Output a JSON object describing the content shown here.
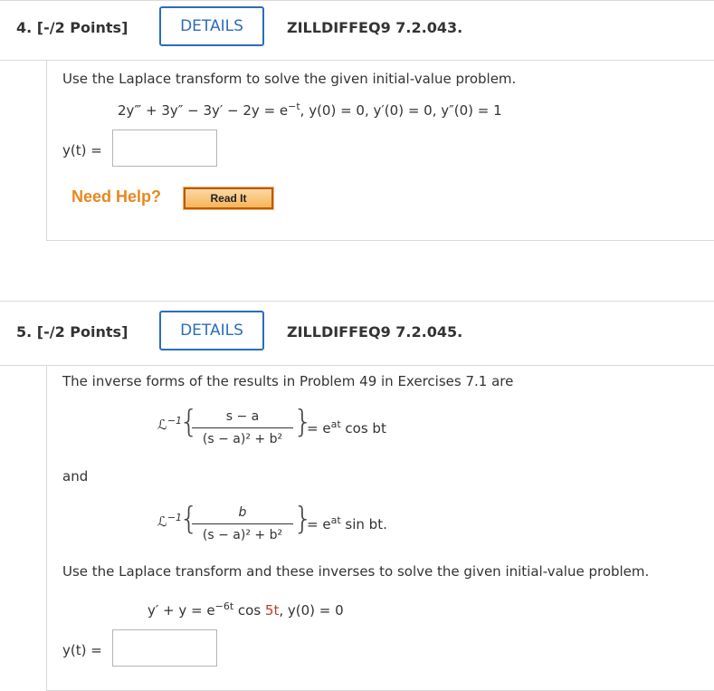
{
  "q4": {
    "number": "4.",
    "points": "[-/2 Points]",
    "details_label": "DETAILS",
    "id": "ZILLDIFFEQ9 7.2.043.",
    "prompt": "Use the Laplace transform to solve the given initial-value problem.",
    "equation": "2y‴ + 3y″ − 3y′ − 2y = e",
    "equation_exp": "−t",
    "conditions": ",   y(0) = 0,   y′(0) = 0,   y″(0) = 1",
    "answer_label": "y(t) =",
    "answer_value": "",
    "need_help": "Need Help?",
    "read_it": "Read It"
  },
  "q5": {
    "number": "5.",
    "points": "[-/2 Points]",
    "details_label": "DETAILS",
    "id": "ZILLDIFFEQ9 7.2.045.",
    "intro": "The inverse forms of the results in Problem 49 in Exercises 7.1 are",
    "inverse1": {
      "op": "ℒ",
      "op_sup": "−1",
      "numerator": "s − a",
      "denominator": "(s − a)² + b²",
      "result": "= e",
      "result_exp": "at",
      "result_tail": " cos bt"
    },
    "and_label": "and",
    "inverse2": {
      "op": "ℒ",
      "op_sup": "−1",
      "numerator": "b",
      "denominator": "(s − a)² + b²",
      "result": "= e",
      "result_exp": "at",
      "result_tail": " sin bt."
    },
    "instruction": "Use the Laplace transform and these inverses to solve the given initial-value problem.",
    "equation": "y′ + y = e",
    "equation_exp": "−6t",
    "equation_cos": " cos ",
    "equation_arg": "5t",
    "conditions": ",   y(0) = 0",
    "answer_label": "y(t) =",
    "answer_value": ""
  },
  "colors": {
    "accent": "#2a6ebb",
    "need_help": "#e8871e",
    "highlight": "#c0392b"
  }
}
